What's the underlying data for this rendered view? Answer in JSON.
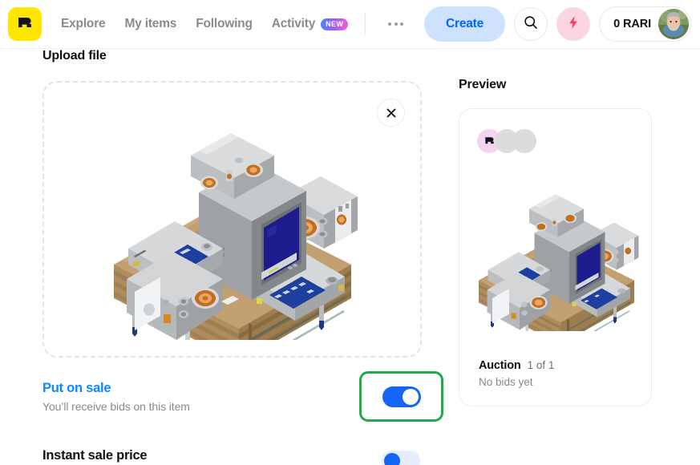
{
  "header": {
    "logo_icon": "rarible-r-logo",
    "nav": [
      {
        "label": "Explore",
        "name": "explore"
      },
      {
        "label": "My items",
        "name": "my-items"
      },
      {
        "label": "Following",
        "name": "following"
      },
      {
        "label": "Activity",
        "name": "activity",
        "badge": "NEW"
      }
    ],
    "more_icon": "more-horizontal-icon",
    "create_label": "Create",
    "search_icon": "search-icon",
    "bolt_icon": "lightning-bolt-icon",
    "wallet_balance": "0 RARI",
    "avatar_icon": "user-avatar"
  },
  "upload": {
    "title": "Upload file",
    "close_icon": "close-icon"
  },
  "sale": {
    "title": "Put on sale",
    "subtitle": "You’ll receive bids on this item",
    "toggle_state": "on"
  },
  "instant": {
    "title": "Instant sale price",
    "toggle_state": "off"
  },
  "preview": {
    "title": "Preview",
    "auction_label": "Auction",
    "edition_count": "1 of 1",
    "bids_status": "No bids yet"
  },
  "colors": {
    "brand_yellow": "#ffe600",
    "accent_blue": "#0d86ff",
    "create_bg": "#cfe2fd",
    "bolt_pink": "#fbd5e2",
    "highlight_green": "#22a94a",
    "toggle_on": "#1464f6",
    "screen_blue": "#1c1c8e",
    "wood": "#b08d5e"
  }
}
